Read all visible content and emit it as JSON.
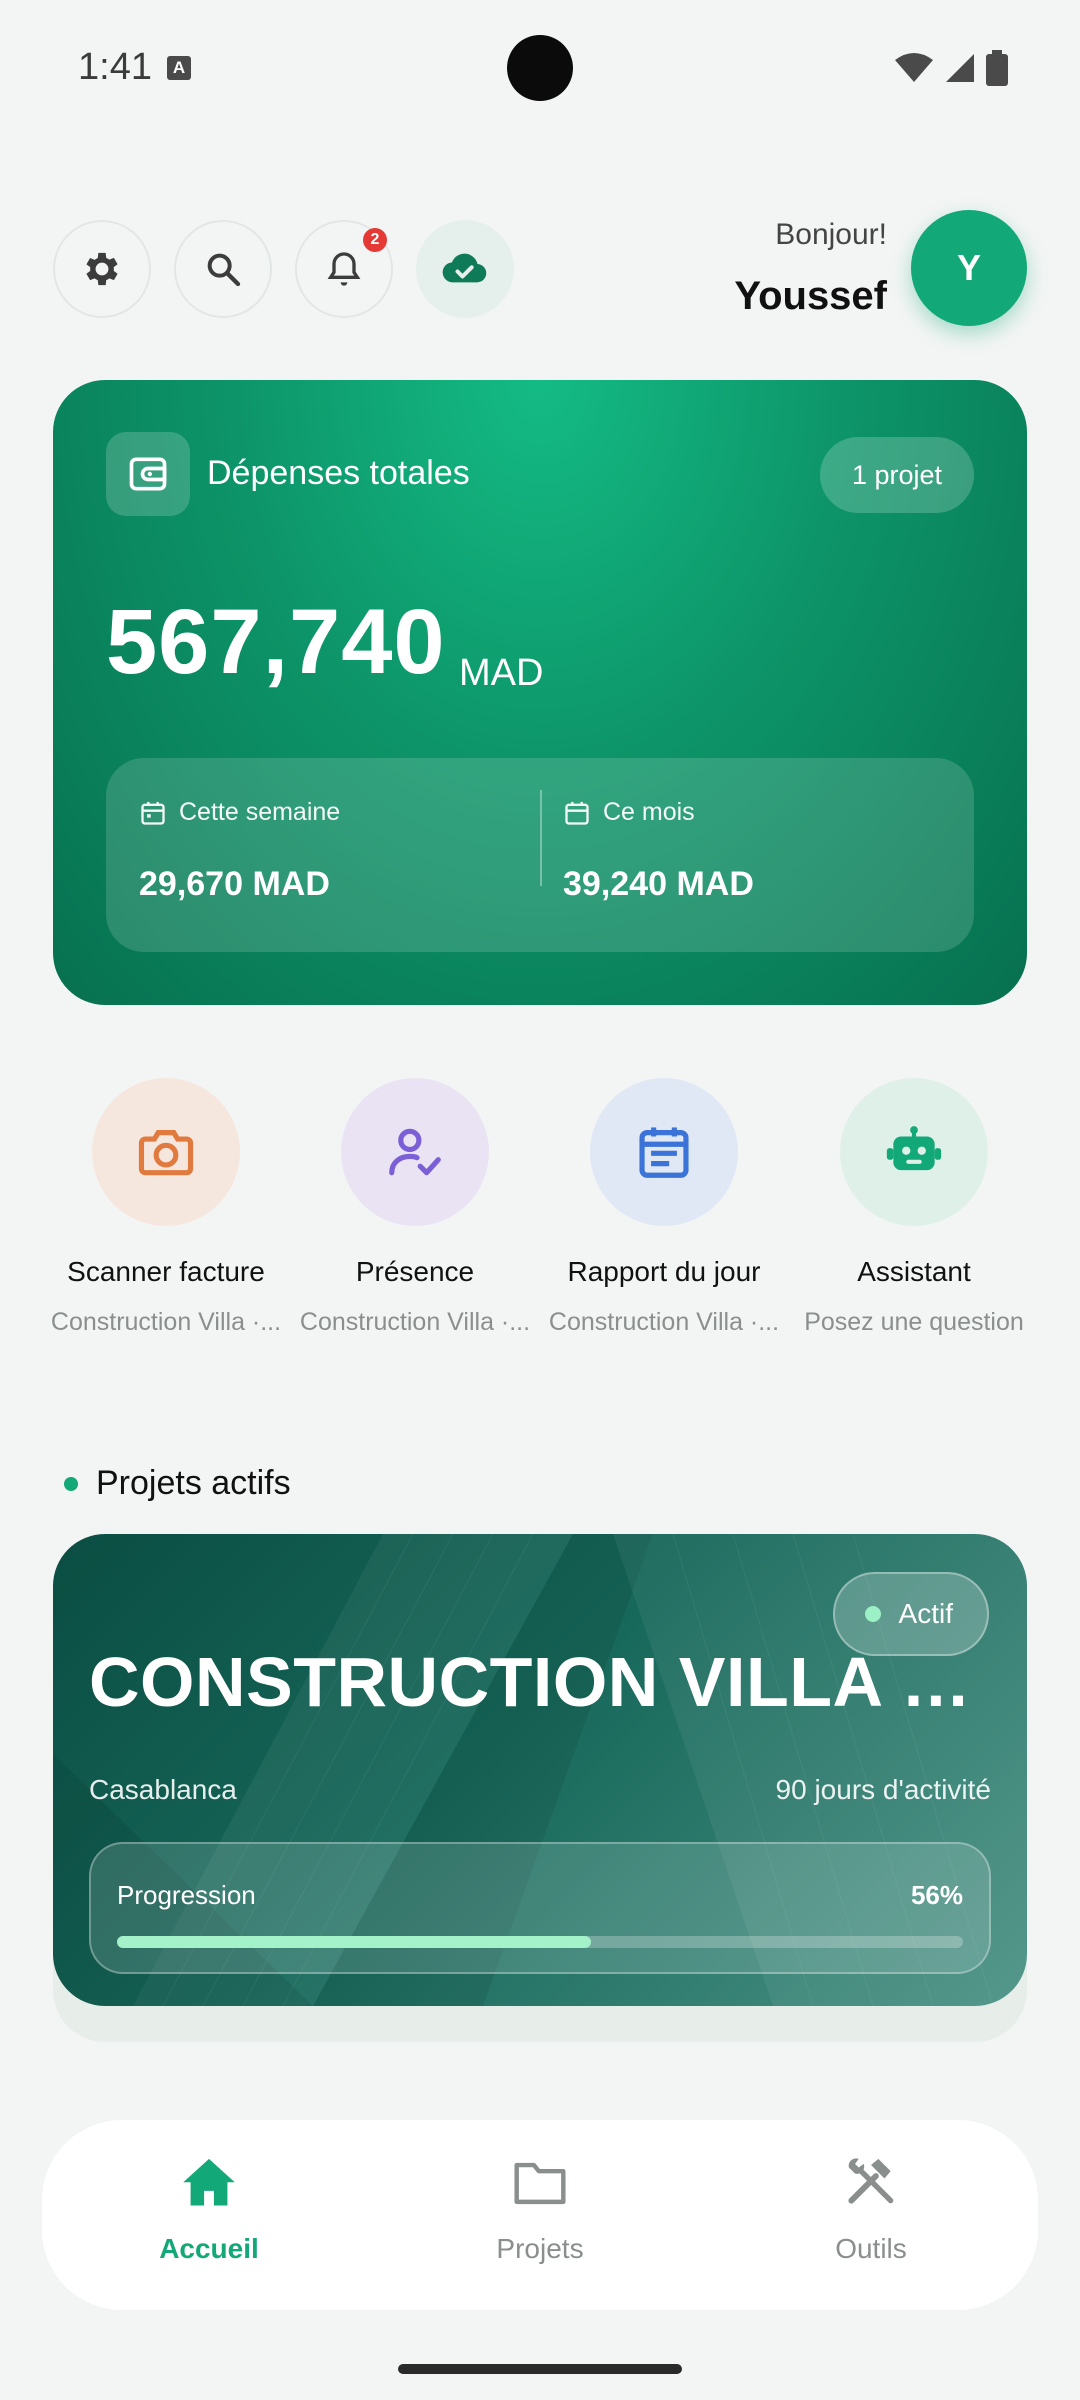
{
  "status_bar": {
    "time": "1:41",
    "indicator": "A"
  },
  "header": {
    "buttons": [
      "gear-icon",
      "search-icon",
      "bell-icon",
      "cloud-check-icon"
    ],
    "notification_count": "2",
    "greeting": "Bonjour!",
    "user_name": "Youssef",
    "avatar_initial": "Y"
  },
  "expenses": {
    "title": "Dépenses totales",
    "project_count": "1 projet",
    "total": "567,740",
    "currency": "MAD",
    "week_label": "Cette semaine",
    "week_value": "29,670 MAD",
    "month_label": "Ce mois",
    "month_value": "39,240 MAD"
  },
  "actions": [
    {
      "title": "Scanner facture",
      "subtitle": "Construction Villa ·...",
      "icon": "camera-icon",
      "color": "#e07a3f",
      "bg": "#f6e7de"
    },
    {
      "title": "Présence",
      "subtitle": "Construction Villa ·...",
      "icon": "user-check-icon",
      "color": "#7b5fd6",
      "bg": "#e9e3f4"
    },
    {
      "title": "Rapport du jour",
      "subtitle": "Construction Villa ·...",
      "icon": "calendar-report-icon",
      "color": "#3b73d8",
      "bg": "#e0e8f5"
    },
    {
      "title": "Assistant",
      "subtitle": "Posez une question",
      "icon": "robot-icon",
      "color": "#13a877",
      "bg": "#dff0e9"
    }
  ],
  "projects": {
    "section_title": "Projets actifs",
    "card": {
      "status": "Actif",
      "name": "CONSTRUCTION VILLA · C...",
      "city": "Casablanca",
      "days": "90 jours d'activité",
      "progress_label": "Progression",
      "progress_text": "56%",
      "progress": 0.56
    }
  },
  "nav": {
    "items": [
      {
        "label": "Accueil",
        "icon": "home-icon",
        "active": true
      },
      {
        "label": "Projets",
        "icon": "folder-icon",
        "active": false
      },
      {
        "label": "Outils",
        "icon": "tools-icon",
        "active": false
      }
    ]
  },
  "colors": {
    "accent": "#13a877",
    "card_dark": "#07704f",
    "background": "#f3f5f4"
  }
}
